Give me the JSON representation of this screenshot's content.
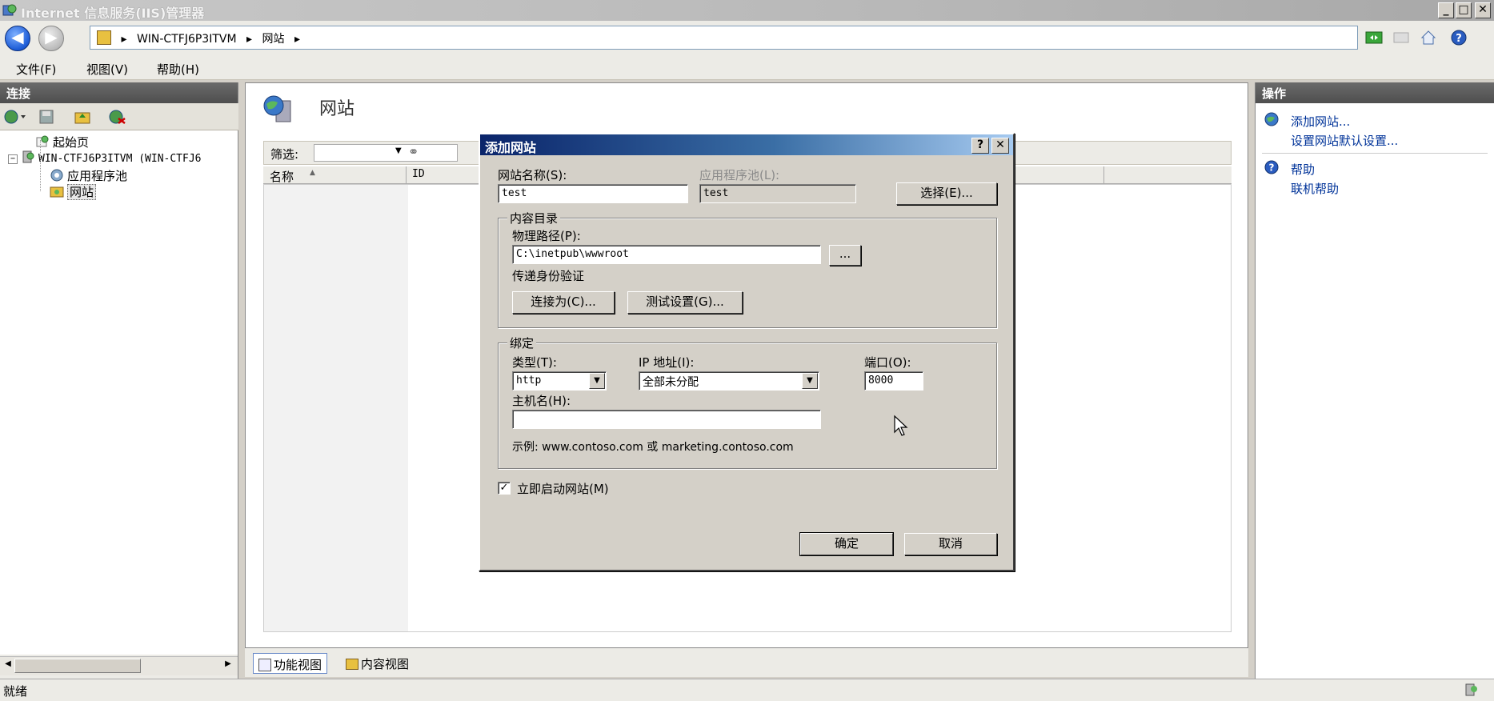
{
  "window": {
    "title": "Internet 信息服务(IIS)管理器",
    "minimize": "_",
    "maximize": "□",
    "close": "✕"
  },
  "address": {
    "segments": [
      "WIN-CTFJ6P3ITVM",
      "网站"
    ],
    "sep": "▸"
  },
  "menu": {
    "file": "文件(F)",
    "view": "视图(V)",
    "help": "帮助(H)"
  },
  "left": {
    "header": "连接",
    "tree": {
      "start_page": "起始页",
      "server": "WIN-CTFJ6P3ITVM (WIN-CTFJ6",
      "app_pools": "应用程序池",
      "sites": "网站"
    }
  },
  "center": {
    "title": "网站",
    "filter_label": "筛选:",
    "col_name": "名称",
    "col_id": "ID"
  },
  "viewtabs": {
    "feature": "功能视图",
    "content": "内容视图"
  },
  "right": {
    "header": "操作",
    "add_site": "添加网站...",
    "site_defaults": "设置网站默认设置...",
    "help": "帮助",
    "online_help": "联机帮助"
  },
  "status": {
    "text": "就绪"
  },
  "dialog": {
    "title": "添加网站",
    "help_btn": "?",
    "close_btn": "✕",
    "site_name_label": "网站名称(S):",
    "site_name_value": "test",
    "app_pool_label": "应用程序池(L):",
    "app_pool_value": "test",
    "select_btn": "选择(E)...",
    "content_dir_label": "内容目录",
    "physical_path_label": "物理路径(P):",
    "physical_path_value": "C:\\inetpub\\wwwroot",
    "browse_btn": "...",
    "pass_through_label": "传递身份验证",
    "connect_as_btn": "连接为(C)...",
    "test_settings_btn": "测试设置(G)...",
    "binding_label": "绑定",
    "type_label": "类型(T):",
    "type_value": "http",
    "ip_label": "IP 地址(I):",
    "ip_value": "全部未分配",
    "port_label": "端口(O):",
    "port_value": "8000",
    "host_label": "主机名(H):",
    "host_value": "",
    "example": "示例: www.contoso.com 或 marketing.contoso.com",
    "start_now_label": "立即启动网站(M)",
    "start_now_checked": "✓",
    "ok_btn": "确定",
    "cancel_btn": "取消"
  }
}
